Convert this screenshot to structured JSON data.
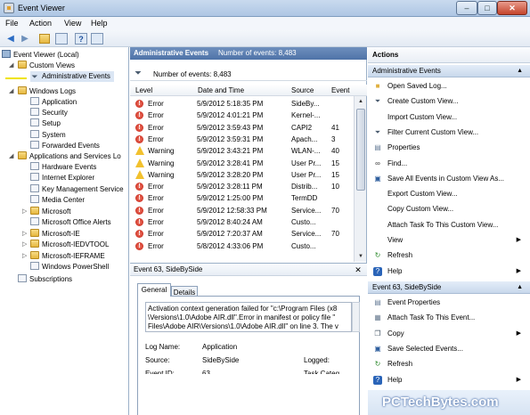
{
  "window": {
    "title": "Event Viewer",
    "min": "–",
    "max": "□",
    "close": "✕"
  },
  "menu": [
    "File",
    "Action",
    "View",
    "Help"
  ],
  "toolbar": {
    "back": "◀",
    "forward": "▶",
    "help": "?"
  },
  "tree": {
    "root": "Event Viewer (Local)",
    "custom_views": "Custom Views",
    "admin_events": "Administrative Events",
    "windows_logs": "Windows Logs",
    "windows_logs_items": [
      "Application",
      "Security",
      "Setup",
      "System",
      "Forwarded Events"
    ],
    "apps_services": "Applications and Services Lo",
    "apps_items": [
      "Hardware Events",
      "Internet Explorer",
      "Key Management Service",
      "Media Center",
      "Microsoft",
      "Microsoft Office Alerts",
      "Microsoft-IE",
      "Microsoft-IEDVTOOL",
      "Microsoft-IEFRAME",
      "Windows PowerShell"
    ],
    "subscriptions": "Subscriptions"
  },
  "center": {
    "header_title": "Administrative Events",
    "header_count": "Number of events: 8,483",
    "filter_count": "Number of events: 8,483",
    "columns": [
      "Level",
      "Date and Time",
      "Source",
      "Event"
    ],
    "rows": [
      {
        "level": "Error",
        "date": "5/9/2012 5:18:35 PM",
        "source": "SideBy...",
        "event": ""
      },
      {
        "level": "Error",
        "date": "5/9/2012 4:01:21 PM",
        "source": "Kernel-...",
        "event": ""
      },
      {
        "level": "Error",
        "date": "5/9/2012 3:59:43 PM",
        "source": "CAPI2",
        "event": "41"
      },
      {
        "level": "Error",
        "date": "5/9/2012 3:59:31 PM",
        "source": "Apach...",
        "event": "3"
      },
      {
        "level": "Warning",
        "date": "5/9/2012 3:43:21 PM",
        "source": "WLAN-...",
        "event": "40"
      },
      {
        "level": "Warning",
        "date": "5/9/2012 3:28:41 PM",
        "source": "User Pr...",
        "event": "15"
      },
      {
        "level": "Warning",
        "date": "5/9/2012 3:28:20 PM",
        "source": "User Pr...",
        "event": "15"
      },
      {
        "level": "Error",
        "date": "5/9/2012 3:28:11 PM",
        "source": "Distrib...",
        "event": "10"
      },
      {
        "level": "Error",
        "date": "5/9/2012 1:25:00 PM",
        "source": "TermDD",
        "event": ""
      },
      {
        "level": "Error",
        "date": "5/9/2012 12:58:33 PM",
        "source": "Service...",
        "event": "70"
      },
      {
        "level": "Error",
        "date": "5/9/2012 8:40:24 AM",
        "source": "Custo...",
        "event": ""
      },
      {
        "level": "Error",
        "date": "5/9/2012 7:20:37 AM",
        "source": "Service...",
        "event": "70"
      },
      {
        "level": "Error",
        "date": "5/8/2012 4:33:06 PM",
        "source": "Custo...",
        "event": ""
      }
    ],
    "detail_title": "Event 63, SideBySide",
    "tab_general": "General",
    "tab_details": "Details",
    "message_lines": [
      "Activation context generation failed for \"c:\\Program Files (x8",
      "\\Versions\\1.0\\Adobe AIR.dll\".Error in manifest or policy file \"",
      "Files\\Adobe AIR\\Versions\\1.0\\Adobe AIR.dll\" on line 3. The v"
    ],
    "log_name_label": "Log Name:",
    "log_name_value": "Application",
    "source_label": "Source:",
    "source_value": "SideBySide",
    "logged_label": "Logged:",
    "event_id_label": "Event ID:",
    "event_id_value": "63",
    "task_label": "Task Categ"
  },
  "actions": {
    "title": "Actions",
    "section1": "Administrative Events",
    "items1": [
      {
        "label": "Open Saved Log...",
        "icon": "folder-icon"
      },
      {
        "label": "Create Custom View...",
        "icon": "filter-icon"
      },
      {
        "label": "Import Custom View...",
        "icon": ""
      },
      {
        "label": "Filter Current Custom View...",
        "icon": "filter-icon"
      },
      {
        "label": "Properties",
        "icon": "properties-icon"
      },
      {
        "label": "Find...",
        "icon": "binoculars-icon"
      },
      {
        "label": "Save All Events in Custom View As...",
        "icon": "save-icon"
      },
      {
        "label": "Export Custom View...",
        "icon": ""
      },
      {
        "label": "Copy Custom View...",
        "icon": ""
      },
      {
        "label": "Attach Task To This Custom View...",
        "icon": ""
      },
      {
        "label": "View",
        "icon": "",
        "sub": "▶"
      },
      {
        "label": "Refresh",
        "icon": "refresh-icon"
      },
      {
        "label": "Help",
        "icon": "help-icon",
        "sub": "▶"
      }
    ],
    "section2": "Event 63, SideBySide",
    "items2": [
      {
        "label": "Event Properties",
        "icon": "properties-icon"
      },
      {
        "label": "Attach Task To This Event...",
        "icon": "task-icon"
      },
      {
        "label": "Copy",
        "icon": "copy-icon",
        "sub": "▶"
      },
      {
        "label": "Save Selected Events...",
        "icon": "save-icon"
      },
      {
        "label": "Refresh",
        "icon": "refresh-icon"
      },
      {
        "label": "Help",
        "icon": "help-icon",
        "sub": "▶"
      }
    ]
  },
  "watermark": "PCTechBytes.com"
}
